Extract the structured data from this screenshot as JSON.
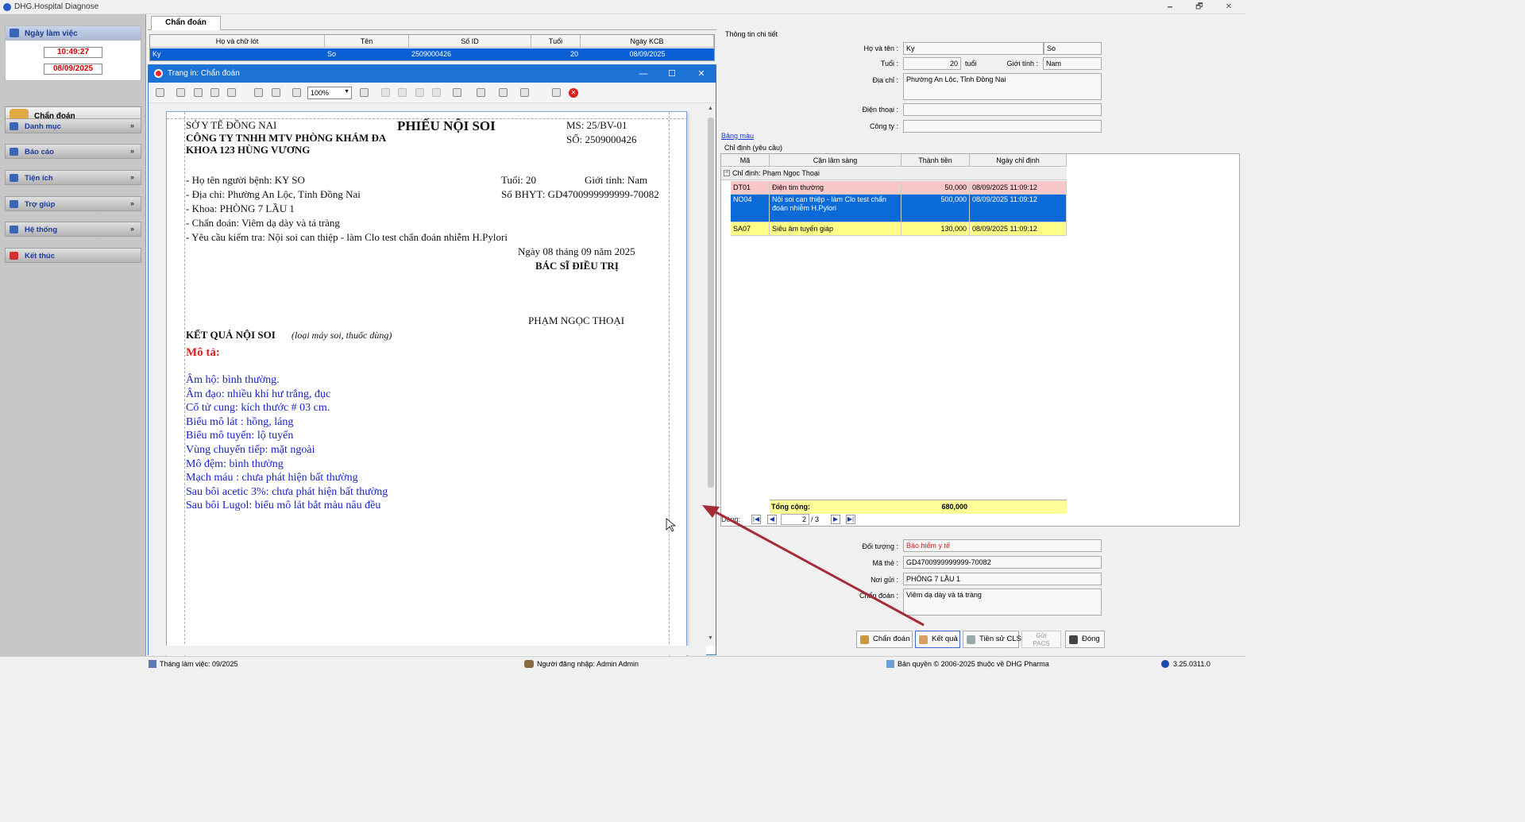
{
  "app": {
    "title": "DHG.Hospital Diagnose",
    "minimize": "🗕",
    "restore": "🗗",
    "close": "✕"
  },
  "sidebar": {
    "date_header": "Ngày làm việc",
    "time": "10:49:27",
    "date": "08/09/2025",
    "active": "Chẩn đoán",
    "items": [
      {
        "label": "Danh mục"
      },
      {
        "label": "Báo cáo"
      },
      {
        "label": "Tiện ích"
      },
      {
        "label": "Trợ giúp"
      },
      {
        "label": "Hệ thống"
      },
      {
        "label": "Kết thúc"
      }
    ],
    "chevron": "»"
  },
  "tab": {
    "label": "Chẩn đoán"
  },
  "patient_grid": {
    "headers": [
      "Họ và chữ lót",
      "Tên",
      "Số ID",
      "Tuổi",
      "Ngày KCB"
    ],
    "row": [
      "Ky",
      "So",
      "2509000426",
      "20",
      "08/09/2025"
    ]
  },
  "print_dialog": {
    "title": "Trang in: Chẩn đoán",
    "zoom": "100%",
    "minimize": "—",
    "maximize": "☐",
    "close": "✕",
    "report": {
      "org1": "SỞ Y TẾ ĐỒNG NAI",
      "org2": "CÔNG TY TNHH MTV PHÒNG KHÁM ĐA",
      "org3": "KHOA 123 HÙNG VƯƠNG",
      "title": "PHIẾU NỘI SOI",
      "ms": "MS: 25/BV-01",
      "so": "SỐ: 2509000426",
      "name": "- Họ tên người bệnh: KY SO",
      "age": "Tuổi: 20",
      "gender": "Giới tính: Nam",
      "address": "- Địa chỉ: Phường An Lộc, Tỉnh Đồng Nai",
      "bhyt": "Số BHYT: GD4700999999999-70082",
      "khoa": "- Khoa: PHÒNG 7 LẦU 1",
      "diag": "- Chẩn đoán: Viêm dạ dày và tá tràng",
      "request": "- Yêu cầu kiểm tra: Nội soi can thiệp - làm Clo test chẩn đoán nhiễm H.Pylori",
      "date": "Ngày 08 tháng 09 năm 2025",
      "doctor_title": "BÁC SĨ ĐIỀU TRỊ",
      "doctor_name": "PHẠM NGỌC THOẠI",
      "result_title": "KẾT QUẢ NỘI SOI",
      "result_sub": "(loại máy soi, thuốc dùng)",
      "mota": "Mô tả:",
      "findings": [
        "Âm hộ: bình thường.",
        "Âm đạo: nhiều khí hư trắng, đục",
        "Cổ tử cung: kích thước # 03  cm.",
        "Biểu mô lát : hồng, láng",
        "Biểu mô tuyến: lộ tuyến",
        "Vùng chuyển tiếp: mặt ngoài",
        "Mô đệm: bình thường",
        "Mạch máu :  chưa phát hiện bất thường",
        "Sau bôi acetic 3%:  chưa phát hiện bất thường",
        "Sau bôi Lugol: biểu mô lát bắt màu nâu đều"
      ]
    }
  },
  "detail": {
    "section": "Thông tin chi tiết",
    "name_label": "Họ và tên :",
    "first": "Ky",
    "last": "So",
    "age_label": "Tuổi :",
    "age": "20",
    "age_unit": "tuổi",
    "gender_label": "Giới tính :",
    "gender": "Nam",
    "address_label": "Địa chỉ :",
    "address": "Phường An Lộc, Tỉnh Đồng Nai",
    "phone_label": "Điện thoại :",
    "company_label": "Công ty :",
    "color_link": "Bảng màu",
    "orders_section": "Chỉ định (yêu cầu)"
  },
  "orders": {
    "headers": [
      "Mã",
      "Cận lâm sàng",
      "Thành tiền",
      "Ngày chỉ định"
    ],
    "group": "Chỉ định:  Phạm Ngọc Thoại",
    "rows": [
      {
        "code": "DT01",
        "name": "Điện tim thường",
        "price": "50,000",
        "date": "08/09/2025 11:09:12",
        "bg": "#f8c8c8",
        "fg": "#000"
      },
      {
        "code": "NO04",
        "name": "Nội soi can thiệp - làm Clo test chẩn đoán nhiễm H.Pylori",
        "price": "500,000",
        "date": "08/09/2025 11:09:12",
        "bg": "#0a6ad8",
        "fg": "#fff"
      },
      {
        "code": "SA07",
        "name": "Siêu âm tuyến giáp",
        "price": "130,000",
        "date": "08/09/2025 11:09:12",
        "bg": "#ffff88",
        "fg": "#000"
      }
    ],
    "total_label": "Tổng cộng:",
    "total": "680,000",
    "pager_label": "Dòng:",
    "page": "2",
    "pages": "/  3"
  },
  "insurance": {
    "doituong_label": "Đối tượng :",
    "doituong": "Bảo hiểm y tế",
    "mathe_label": "Mã thẻ :",
    "mathe": "GD4700999999999-70082",
    "noigui_label": "Nơi gửi :",
    "noigui": "PHÒNG 7 LẦU 1",
    "chandoan_label": "Chẩn đoán :",
    "chandoan": "Viêm dạ dày và tá tràng"
  },
  "buttons": {
    "chandoan": "Chẩn đoán",
    "ketqua": "Kết quả",
    "tiensu": "Tiền sử CLS",
    "guipacs1": "Gửi",
    "guipacs2": "PACS",
    "dong": "Đóng"
  },
  "status": {
    "month": "Tháng làm việc: 09/2025",
    "user": "Người đăng nhập: Admin Admin",
    "copyright": "Bản quyền © 2006-2025 thuộc về DHG Pharma",
    "version": "3.25.0311.0"
  },
  "colors": {
    "accent": "#1d72d6",
    "selected": "#0a6ad8",
    "arrow": "#a52a3a",
    "report_blue": "#1a22cc"
  }
}
